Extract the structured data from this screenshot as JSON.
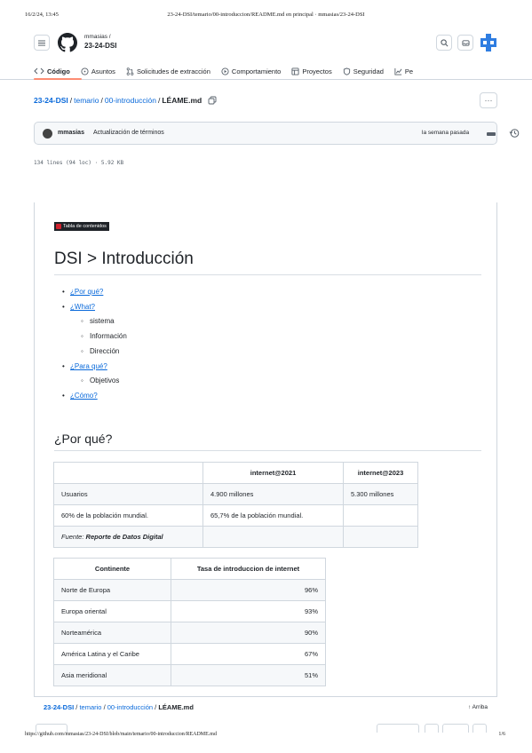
{
  "print_header": {
    "datetime": "16/2/24, 13:45",
    "title": "23-24-DSI/temario/00-introduccion/README.md en principal · mmasias/23-24-DSI"
  },
  "print_footer": {
    "url": "https://github.com/mmasias/23-24-DSI/blob/main/temario/00-introduccion/README.md",
    "page": "1/6"
  },
  "header": {
    "owner": "mmasias /",
    "repo": "23-24-DSI",
    "icons": [
      "menu-icon",
      "github-logo-icon",
      "search-icon",
      "inbox-icon",
      "copilot-icon"
    ]
  },
  "tabs": [
    {
      "label": "Código",
      "icon": "code-icon",
      "active": true
    },
    {
      "label": "Asuntos",
      "icon": "issue-icon"
    },
    {
      "label": "Solicitudes de extracción",
      "icon": "pull-request-icon"
    },
    {
      "label": "Comportamiento",
      "icon": "play-icon"
    },
    {
      "label": "Proyectos",
      "icon": "table-icon"
    },
    {
      "label": "Seguridad",
      "icon": "shield-icon"
    },
    {
      "label": "Pe",
      "icon": "graph-icon"
    }
  ],
  "accent": {
    "link": "#0969da",
    "tab_underline": "#fd8c73"
  },
  "breadcrumb": {
    "repo": "23-24-DSI",
    "sep": "/",
    "dir1": "temario",
    "dir2": "00-introducción",
    "file": "LÉAME.md"
  },
  "commit": {
    "author": "mmasias",
    "message": "Actualización de términos",
    "when": "la semana pasada"
  },
  "file_meta": "134 lines (94 loc) · 5.92 KB",
  "readme": {
    "toc_badge": "Tabla de contenidos",
    "title": "DSI > Introducción",
    "toc": {
      "por_que": "¿Por qué?",
      "what": "¿What?",
      "what_sub": [
        "sistema",
        "Información",
        "Dirección"
      ],
      "para_que": "¿Para qué?",
      "para_que_sub": [
        "Objetivos"
      ],
      "como": "¿Cómo?"
    },
    "section_title": "¿Por qué?",
    "table1": {
      "headers": [
        "",
        "internet@2021",
        "internet@2023"
      ],
      "rows": [
        [
          "Usuarios",
          "4.900 millones",
          "5.300 millones"
        ],
        [
          "60% de la población mundial.",
          "65,7% de la población mundial.",
          ""
        ],
        [
          "Fuente: Reporte de Datos Digital",
          "",
          ""
        ]
      ],
      "source_prefix": "Fuente: ",
      "source_name": "Reporte de Datos Digital"
    },
    "table2": {
      "headers": [
        "Continente",
        "Tasa de introduccion de internet"
      ],
      "rows": [
        [
          "Norte de Europa",
          "96%"
        ],
        [
          "Europa oriental",
          "93%"
        ],
        [
          "Norteamérica",
          "90%"
        ],
        [
          "América Latina y el Caribe",
          "67%"
        ],
        [
          "Asia meridional",
          "51%"
        ]
      ]
    }
  },
  "sticky": {
    "top_label": "↑ Arriba"
  }
}
